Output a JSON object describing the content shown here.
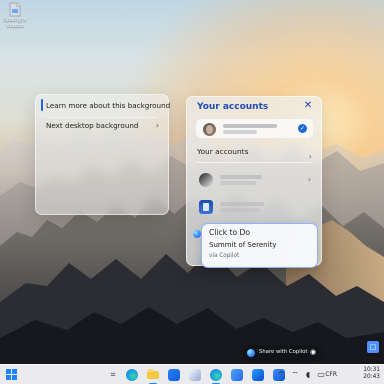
{
  "desktop": {
    "spotlight_label": "Spotlight\nVideos"
  },
  "context_menu": {
    "item1": "Learn more about this background",
    "item2": "Next desktop background"
  },
  "accounts_panel": {
    "title": "Your accounts",
    "section_label": "Your accounts"
  },
  "click_to_do": {
    "title": "Click to Do",
    "subtitle": "Summit of Serenity",
    "source": "via Copilot"
  },
  "copilot_bar": {
    "label": "Share with Copilot"
  },
  "taskbar": {
    "language": "CFR",
    "time": "10:31",
    "date": "20:43"
  },
  "colors": {
    "accent": "#1f84ff",
    "copilot_blue": "#3b8fff",
    "panel_title": "#1f4db7"
  }
}
